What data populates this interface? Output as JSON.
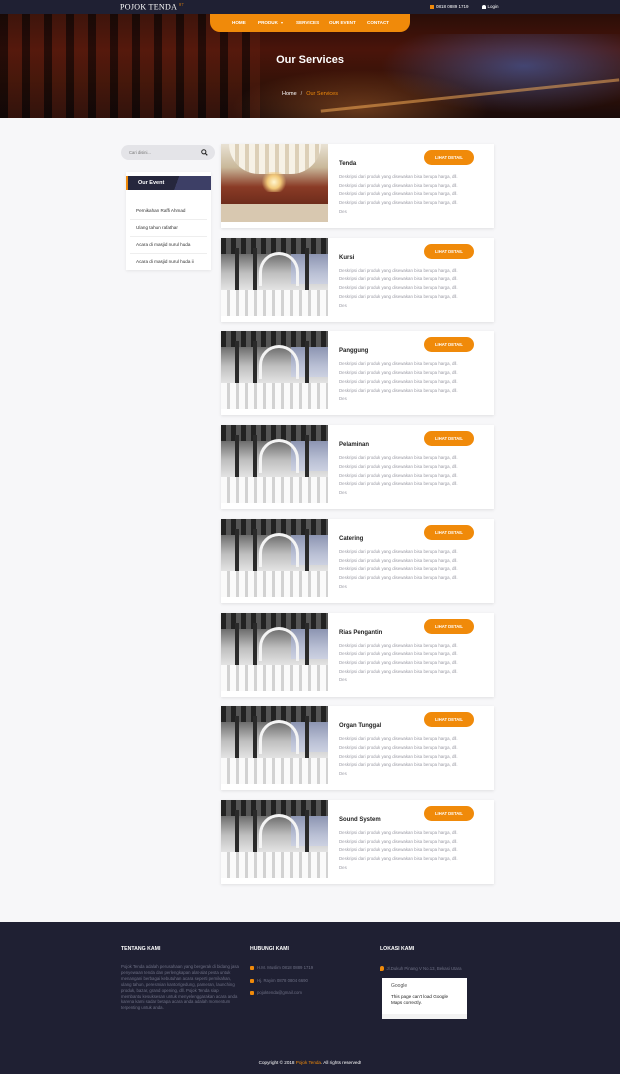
{
  "topbar": {
    "brand": "POJOK TENDA",
    "brand_sup": "87",
    "phone": "0818 0889 1719",
    "login": "Login"
  },
  "nav": {
    "items": [
      {
        "label": "HOME",
        "active": true
      },
      {
        "label": "PRODUK",
        "has_dropdown": true
      },
      {
        "label": "SERVICES"
      },
      {
        "label": "OUR EVENT"
      },
      {
        "label": "CONTACT"
      }
    ]
  },
  "hero": {
    "title": "Our Services",
    "breadcrumb": {
      "home": "Home",
      "separator": "/",
      "current": "Our Services"
    }
  },
  "sidebar": {
    "search_placeholder": "Cari disini...",
    "card_title": "Our Event",
    "events": [
      "Pernikahan Raffi Ahmad",
      "Ulang tahun rafathar",
      "Acara di masjid nurul huda",
      "Acara di masjid nurul huda ii"
    ]
  },
  "services": {
    "button_label": "LIHAT DETAIL",
    "description": "Deskripsi dari produk yang disewakan bisa berupa harga, dll. Deskripsi dari produk yang disewakan bisa berupa harga, dll. Deskripsi dari produk yang disewakan bisa berupa harga, dll. Deskripsi dari produk yang disewakan bisa berupa harga, dll. Des",
    "items": [
      {
        "title": "Tenda",
        "image": "tenda"
      },
      {
        "title": "Kursi",
        "image": "hall"
      },
      {
        "title": "Panggung",
        "image": "hall"
      },
      {
        "title": "Pelaminan",
        "image": "hall"
      },
      {
        "title": "Catering",
        "image": "hall"
      },
      {
        "title": "Rias Pengantin",
        "image": "hall"
      },
      {
        "title": "Organ Tunggal",
        "image": "hall"
      },
      {
        "title": "Sound System",
        "image": "hall"
      }
    ]
  },
  "footer": {
    "about_heading": "TENTANG KAMI",
    "about_text": "Pojok Tenda adalah perusahaan yang bergerak di bidang jasa penyewaan tenda dan perlengkapan alat-alat pesta untuk menangani berbagai kebutuhan acara seperti pernikahan, ulang tahun, peresmian kantor/gedung, pameran, launching produk, bazar, grand opening, dll. Pojok Tenda siap membantu kesuksesan untuk menyelenggarakan acara anda karena kami sadar betapa acara anda adalah momentum terpenting untuk anda.",
    "contact_heading": "HUBUNGI KAMI",
    "contacts": [
      "H.M. Muslim 0818 0889 1719",
      "Hj. Rayim 0878 0804 6690",
      "pojoktenda@gmail.com"
    ],
    "location_heading": "LOKASI KAMI",
    "address": "Jl.Dukuh Pinang V No.13, Bekasi Utara",
    "map_brand": "Google",
    "map_error": "This page can't load Google Maps correctly.",
    "copyright_prefix": "Copyright © 2018",
    "copyright_brand": "Pojok Tenda",
    "copyright_suffix": ". All rights reserved!"
  },
  "colors": {
    "accent": "#f08a0a",
    "dark": "#1f2033",
    "page_bg": "#f7f7f9"
  }
}
